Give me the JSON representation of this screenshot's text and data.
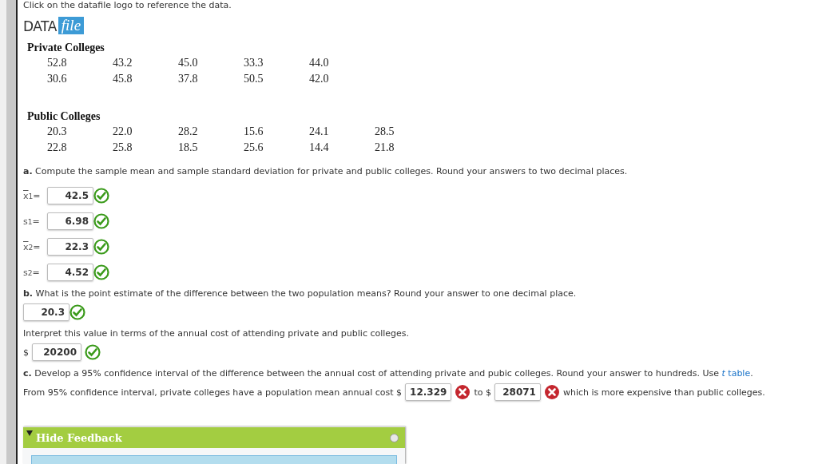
{
  "intro": "Click on the datafile logo to reference the data.",
  "logo": {
    "word": "DATA",
    "tag": "file"
  },
  "datasets": [
    {
      "title": "Private Colleges",
      "rows": [
        [
          "52.8",
          "43.2",
          "45.0",
          "33.3",
          "44.0"
        ],
        [
          "30.6",
          "45.8",
          "37.8",
          "50.5",
          "42.0"
        ]
      ]
    },
    {
      "title": "Public Colleges",
      "rows": [
        [
          "20.3",
          "22.0",
          "28.2",
          "15.6",
          "24.1",
          "28.5"
        ],
        [
          "22.8",
          "25.8",
          "18.5",
          "25.6",
          "14.4",
          "21.8"
        ]
      ]
    }
  ],
  "part_a": {
    "letter": "a.",
    "question": "Compute the sample mean and sample standard deviation for private and public colleges. Round your answers to two decimal places.",
    "answers": [
      {
        "symbol": "x",
        "subscript": "1",
        "operator": "=",
        "bar": true,
        "value": "42.5",
        "correct": true
      },
      {
        "symbol": "s",
        "subscript": "1",
        "operator": " =",
        "bar": false,
        "value": "6.98",
        "correct": true
      },
      {
        "symbol": "x",
        "subscript": "2",
        "operator": "=",
        "bar": true,
        "value": "22.3",
        "correct": true
      },
      {
        "symbol": "s",
        "subscript": "2",
        "operator": " =",
        "bar": false,
        "value": "4.52",
        "correct": true
      }
    ]
  },
  "part_b": {
    "letter": "b.",
    "question": "What is the point estimate of the difference between the two population means? Round your answer to one decimal place.",
    "answer": {
      "value": "20.3",
      "correct": true
    },
    "interpret": "Interpret this value in terms of the annual cost of attending private and public colleges.",
    "answer2": {
      "prefix": "$",
      "value": "20200",
      "correct": true
    }
  },
  "part_c": {
    "letter": "c.",
    "question": "Develop a 95% confidence interval of the difference between the annual cost of attending private and pubic colleges. Round your answer to hundreds. Use",
    "link_italic": "t",
    "link": "table",
    "end": ".",
    "parts": [
      {
        "kind": "text",
        "text": "From 95% confidence interval, private colleges have a population mean annual cost $"
      },
      {
        "kind": "field",
        "value": "12.329",
        "correct": false
      },
      {
        "kind": "text",
        "text": "to $"
      },
      {
        "kind": "field",
        "value": "28071",
        "correct": false
      },
      {
        "kind": "text",
        "text": "which is more expensive than public colleges."
      }
    ]
  },
  "feedback": {
    "label": "Hide Feedback"
  }
}
